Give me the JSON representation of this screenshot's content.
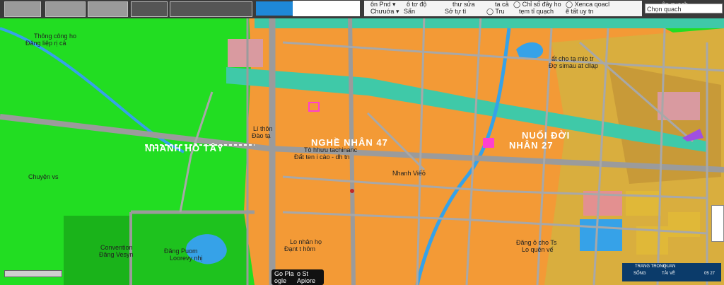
{
  "toolbar": {
    "search_placeholder": "Chọn quach",
    "search_top": "ôn quach",
    "chips": [
      {
        "id": "c1",
        "top": "ôn Pnd ▾",
        "bottom": "Chưuớa ▾"
      },
      {
        "id": "c2",
        "top": "ô tơ độ",
        "bottom": "Sẩn"
      },
      {
        "id": "c3",
        "top": "thư sửa",
        "bottom": "Sở tự tì"
      },
      {
        "id": "c4",
        "top": "ta cả",
        "bottom": "◯ Tru"
      },
      {
        "id": "c5",
        "top": "◯ Chỉ số đây ho",
        "bottom": "tẹm tỉ quạch"
      },
      {
        "id": "c6",
        "top": "◯ Xenca qoacl",
        "bottom": "ẽ tất uy tn"
      }
    ]
  },
  "labels": {
    "l1": "Thông công ho",
    "l2": "Đăng liệp rị cả",
    "l3": "ất cho tạ mio tr",
    "l4": "Đợ simau at cllạp",
    "l5": "Lí thôn",
    "l6": "Đào tạ",
    "l7": "Tô hhưu tachinanc",
    "l8": "Đất ten i cào - dh tn",
    "l9": "Nhanh Viếỏ",
    "l10": "Chuyện vs",
    "l11": "Lo nhân họ",
    "l12": "Đạnt t hôm",
    "l13": "Đăng ỏ cho Ts",
    "l14": "Lo quên vế",
    "l15": "Đăng Puom",
    "l16": "Loorevy nhị",
    "l17": "Convention",
    "l18": "Đăng Vesyn",
    "big1": "NGHỀ NHÂN 47",
    "big2": "NHANH HỒ TÂY",
    "big3": "NHÂN 27",
    "big4": "NUỐI ĐỜI"
  },
  "store": {
    "google_top": "Go Pla",
    "google_bottom": "ogle",
    "apple_top": "o St",
    "apple_bottom": "Apiore"
  },
  "controls": {
    "b1": "TRANG TRONG",
    "b2": "SỐNG",
    "b3": "QUAN",
    "b4": "TÀI VỀ",
    "b5": "05 27"
  },
  "colors": {
    "green": "#22dd22",
    "orange": "#f39a36",
    "teal": "#3fc9a8",
    "gray": "#9b9b9b",
    "blue": "#36a2e8"
  }
}
